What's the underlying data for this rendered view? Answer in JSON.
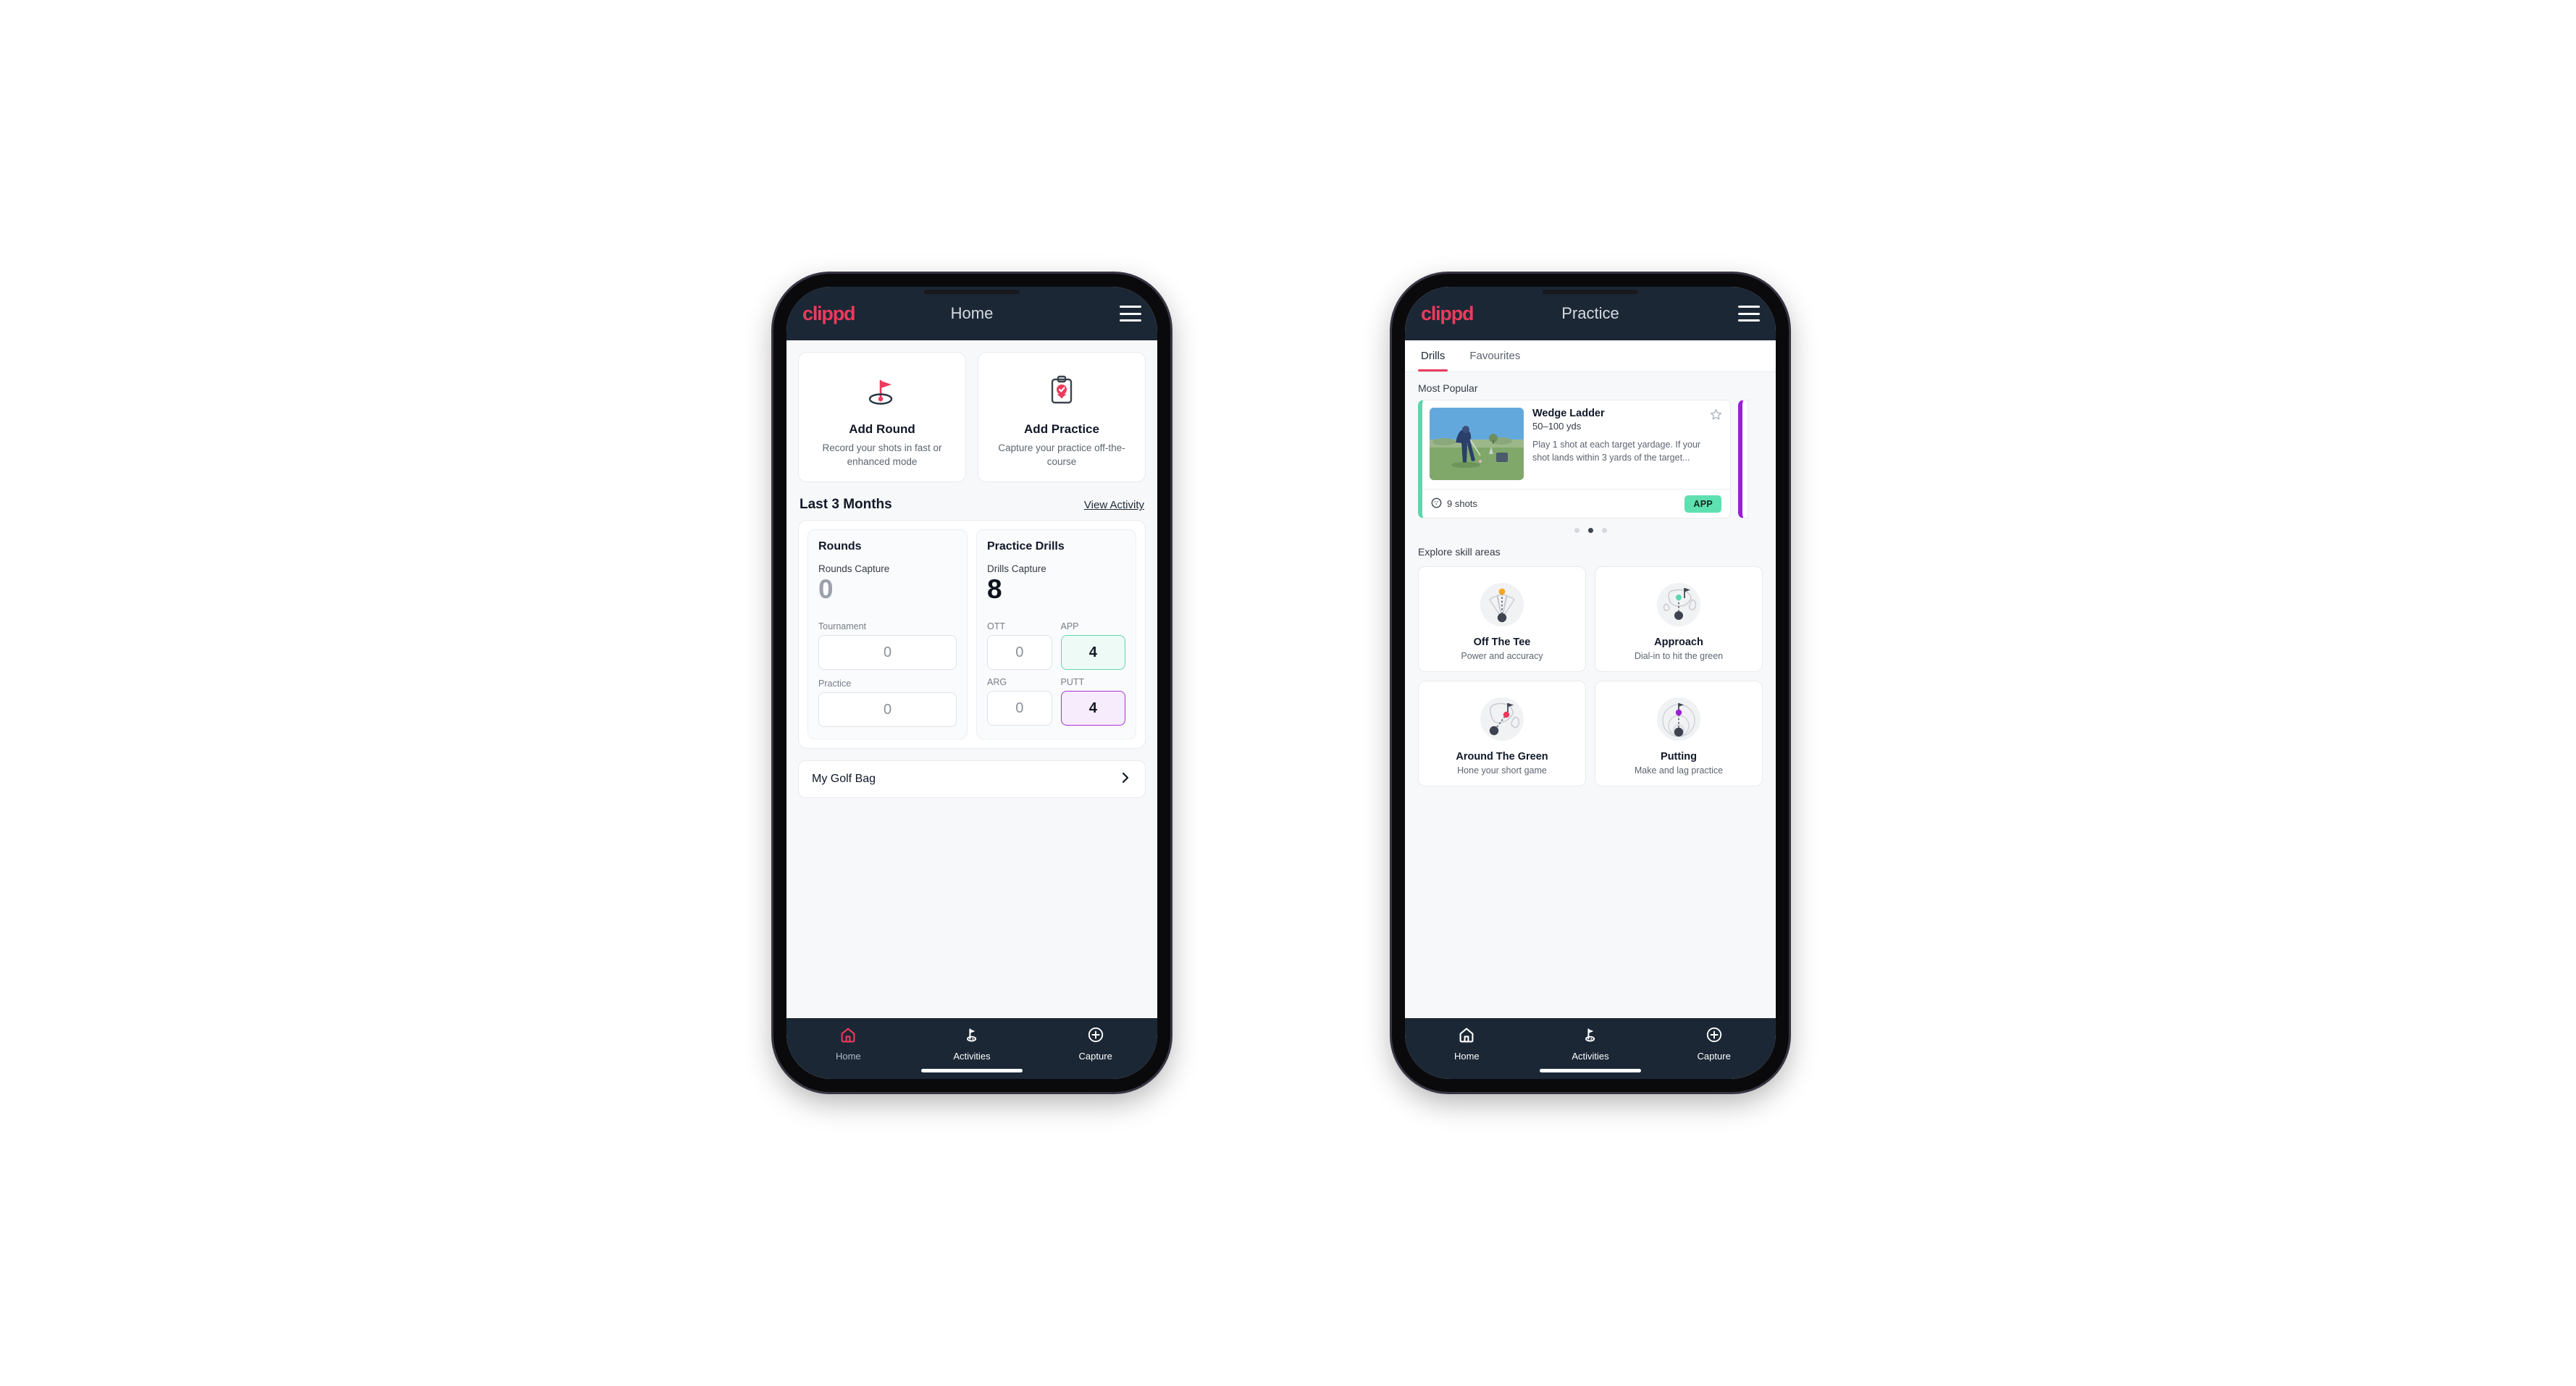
{
  "brand": {
    "logo_text": "clippd",
    "accent": "#ed3a5c",
    "appbar_bg": "#1b2735"
  },
  "phone_home": {
    "appbar": {
      "title": "Home",
      "menu_icon": "hamburger-icon"
    },
    "actions": [
      {
        "icon": "golf-flag-hole-icon",
        "title": "Add Round",
        "subtitle": "Record your shots in fast or enhanced mode"
      },
      {
        "icon": "clipboard-check-icon",
        "title": "Add Practice",
        "subtitle": "Capture your practice off-the-course"
      }
    ],
    "section": {
      "title": "Last 3 Months",
      "link": "View Activity"
    },
    "rounds": {
      "heading": "Rounds",
      "capture_label": "Rounds Capture",
      "capture_value": "0",
      "fields": [
        {
          "label": "Tournament",
          "value": "0"
        },
        {
          "label": "Practice",
          "value": "0"
        }
      ]
    },
    "drills": {
      "heading": "Practice Drills",
      "capture_label": "Drills Capture",
      "capture_value": "8",
      "fields": [
        {
          "label": "OTT",
          "value": "0",
          "style": "plain"
        },
        {
          "label": "APP",
          "value": "4",
          "style": "app",
          "color": "#5fd6ad"
        },
        {
          "label": "ARG",
          "value": "0",
          "style": "plain"
        },
        {
          "label": "PUTT",
          "value": "4",
          "style": "putt",
          "color": "#a435d6"
        }
      ]
    },
    "golf_bag": {
      "label": "My Golf Bag",
      "chevron_icon": "chevron-right-icon"
    },
    "nav": [
      {
        "icon": "home-icon",
        "label": "Home",
        "active": true
      },
      {
        "icon": "golf-flag-icon",
        "label": "Activities",
        "active": false
      },
      {
        "icon": "plus-circle-icon",
        "label": "Capture",
        "active": false
      }
    ]
  },
  "phone_practice": {
    "appbar": {
      "title": "Practice",
      "menu_icon": "hamburger-icon"
    },
    "tabs": [
      {
        "label": "Drills",
        "active": true
      },
      {
        "label": "Favourites",
        "active": false
      }
    ],
    "most_popular_label": "Most Popular",
    "drill": {
      "title": "Wedge Ladder",
      "subtitle": "50–100 yds",
      "description": "Play 1 shot at each target yardage. If your shot lands within 3 yards of the target...",
      "shots": "9 shots",
      "shots_icon": "golf-ball-icon",
      "badge": "APP",
      "badge_color": "#5fe0b0",
      "accent": "#5fd6ad",
      "favourite_icon": "star-outline-icon",
      "thumbnail": "golfer-wedge-photo"
    },
    "next_card_accent": "#9a1fd8",
    "pagination": {
      "count": 3,
      "active_index": 1
    },
    "skill_label": "Explore skill areas",
    "skills": [
      {
        "icon": "tee-fan-icon",
        "title": "Off The Tee",
        "subtitle": "Power and accuracy",
        "dot": "#f5a623"
      },
      {
        "icon": "green-approach-icon",
        "title": "Approach",
        "subtitle": "Dial-in to hit the green",
        "dot": "#5fd6ad"
      },
      {
        "icon": "chip-green-icon",
        "title": "Around The Green",
        "subtitle": "Hone your short game",
        "dot": "#ed3a5c"
      },
      {
        "icon": "putting-rings-icon",
        "title": "Putting",
        "subtitle": "Make and lag practice",
        "dot": "#9a1fd8"
      }
    ],
    "nav": [
      {
        "icon": "home-icon",
        "label": "Home",
        "active": false
      },
      {
        "icon": "golf-flag-icon",
        "label": "Activities",
        "active": false
      },
      {
        "icon": "plus-circle-icon",
        "label": "Capture",
        "active": false
      }
    ]
  }
}
